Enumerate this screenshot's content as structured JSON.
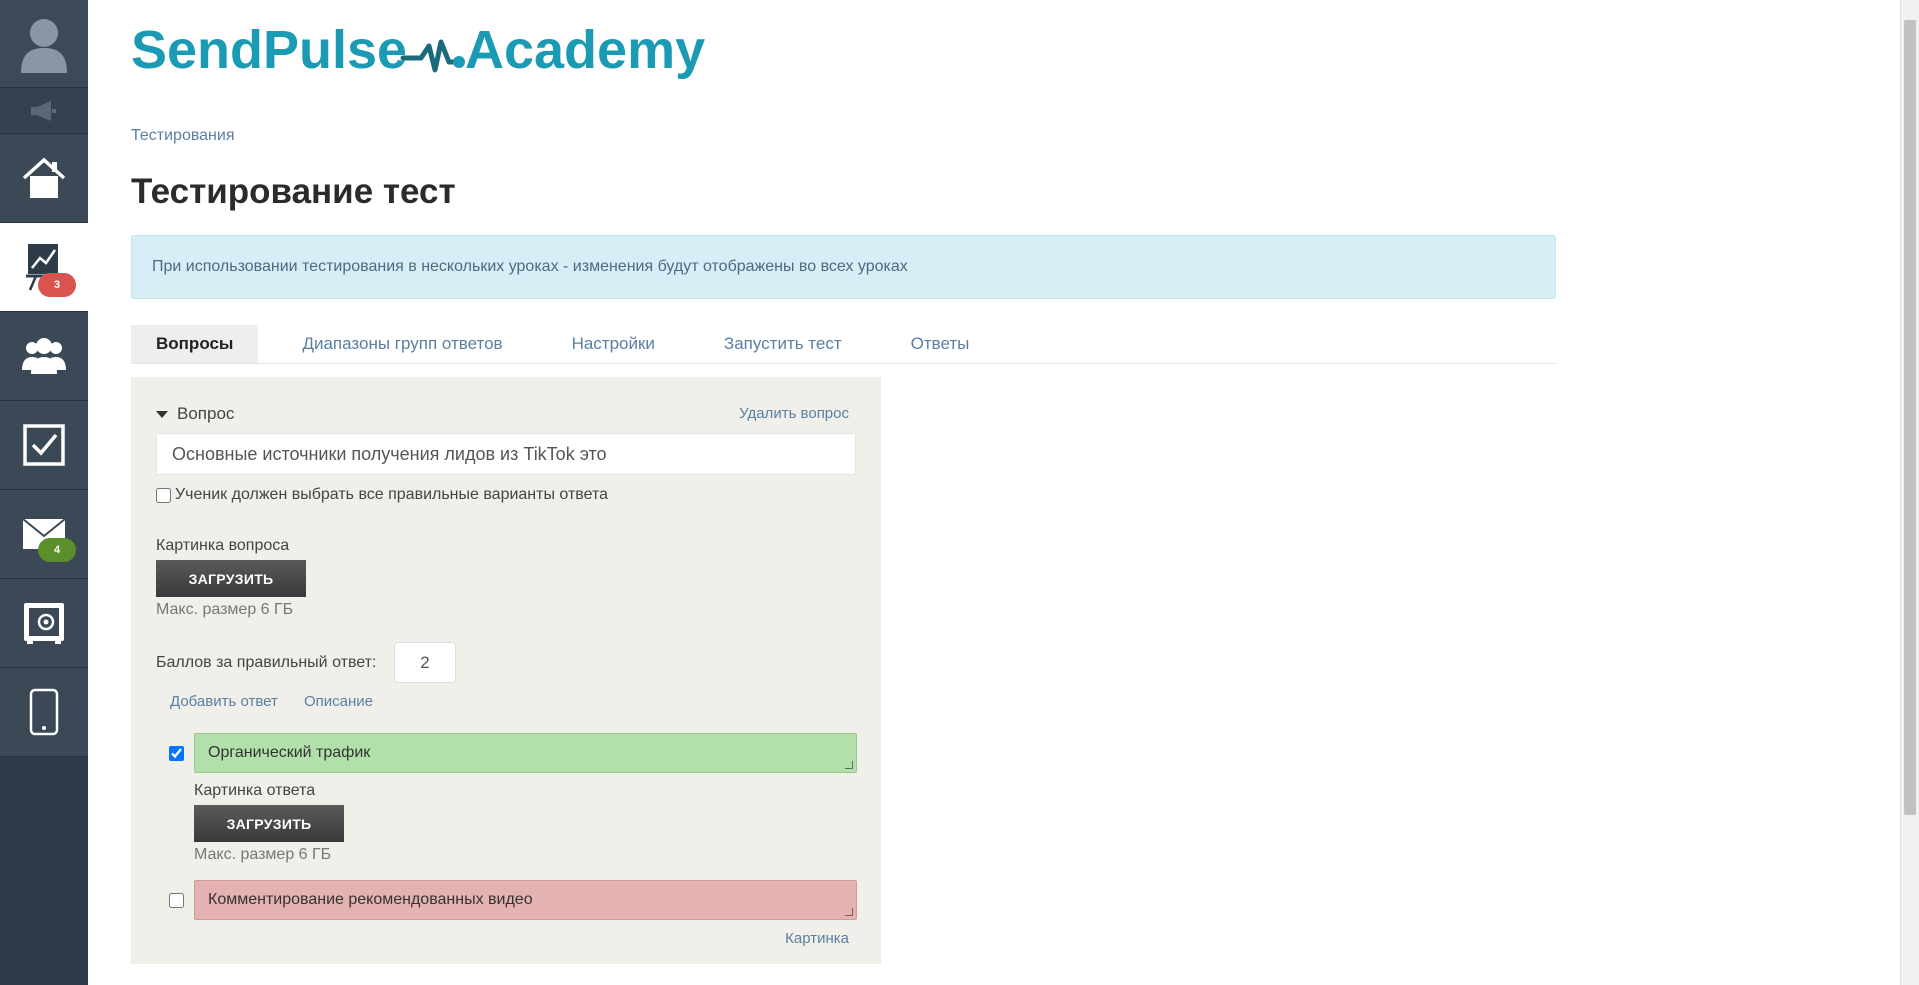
{
  "sidebar": {
    "items": [
      {
        "name": "home",
        "icon": "home-icon"
      },
      {
        "name": "courses",
        "icon": "chart-board-icon",
        "badge": "3",
        "active": true
      },
      {
        "name": "users",
        "icon": "users-icon"
      },
      {
        "name": "tasks",
        "icon": "checkbox-icon"
      },
      {
        "name": "mail",
        "icon": "mail-icon",
        "badge": "4"
      },
      {
        "name": "settings",
        "icon": "safe-gear-icon"
      },
      {
        "name": "mobile",
        "icon": "phone-icon"
      }
    ]
  },
  "logo": {
    "part1": "SendPulse",
    "part2": "Academy",
    "color": "#1a9bb3"
  },
  "breadcrumb": "Тестирования",
  "page_title": "Тестирование тест",
  "alert": "При использовании тестирования в нескольких уроках - изменения будут отображены во всех уроках",
  "tabs": [
    {
      "label": "Вопросы",
      "active": true
    },
    {
      "label": "Диапазоны групп ответов"
    },
    {
      "label": "Настройки"
    },
    {
      "label": "Запустить тест"
    },
    {
      "label": "Ответы"
    }
  ],
  "question": {
    "header": "Вопрос",
    "delete_label": "Удалить вопрос",
    "text": "Основные источники получения лидов из TikTok это",
    "all_correct_label": "Ученик должен выбрать все правильные варианты ответа",
    "image_label": "Картинка вопроса",
    "upload_label": "ЗАГРУЗИТЬ",
    "max_size": "Макс. размер 6 ГБ",
    "score_label": "Баллов за правильный ответ:",
    "score_value": "2",
    "add_answer": "Добавить ответ",
    "description": "Описание",
    "answers": [
      {
        "text": "Органический трафик",
        "correct": true,
        "image_label": "Картинка ответа",
        "upload_label": "ЗАГРУЗИТЬ",
        "max_size": "Макс. размер 6 ГБ"
      },
      {
        "text": "Комментирование рекомендованных видео",
        "correct": false,
        "image_link": "Картинка"
      }
    ]
  }
}
